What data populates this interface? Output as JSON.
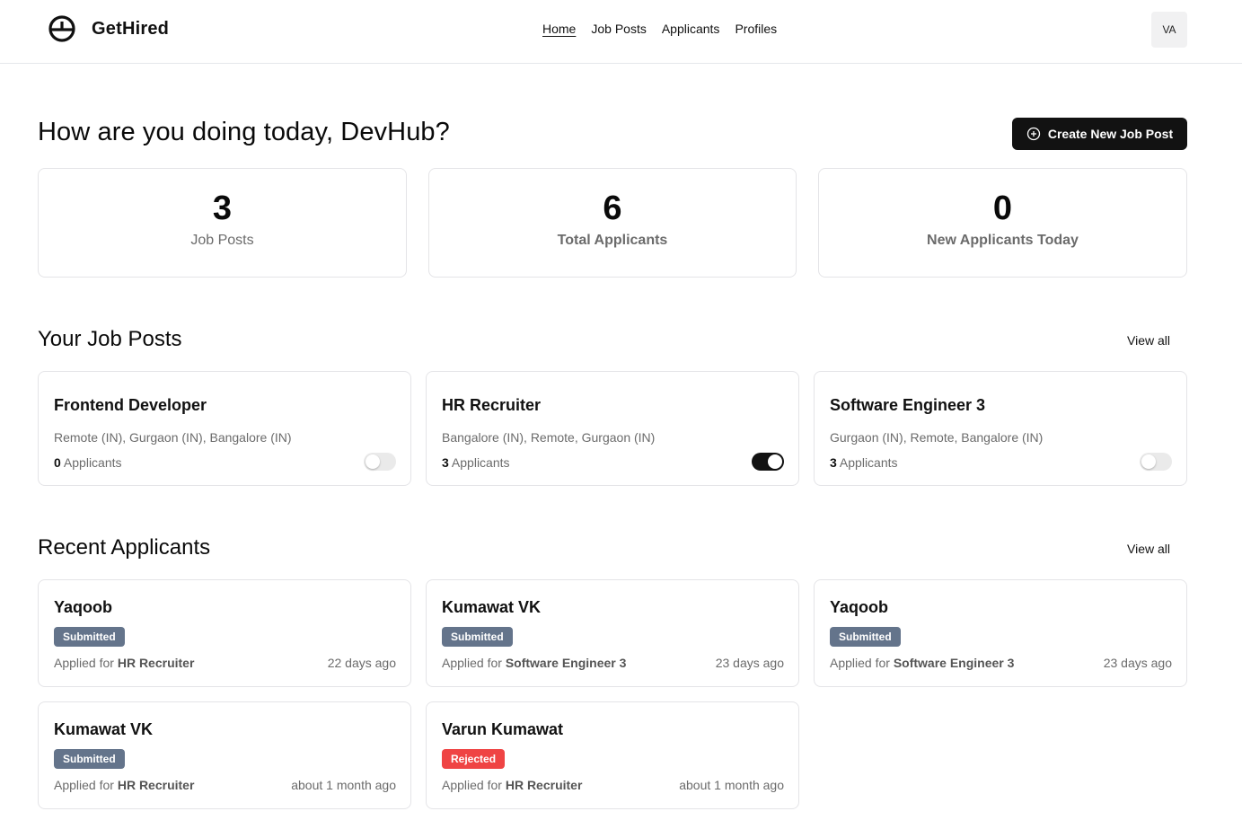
{
  "brand": {
    "name": "GetHired",
    "logo_icon": "brand-logo-icon"
  },
  "nav": [
    {
      "label": "Home",
      "active": true
    },
    {
      "label": "Job Posts",
      "active": false
    },
    {
      "label": "Applicants",
      "active": false
    },
    {
      "label": "Profiles",
      "active": false
    }
  ],
  "user": {
    "initials": "VA"
  },
  "greeting": "How are you doing today, DevHub?",
  "create_button": {
    "label": "Create New Job Post",
    "icon": "plus-circle-icon"
  },
  "stats": [
    {
      "value": "3",
      "label": "Job Posts"
    },
    {
      "value": "6",
      "label": "Total Applicants"
    },
    {
      "value": "0",
      "label": "New Applicants Today"
    }
  ],
  "job_posts_section": {
    "title": "Your Job Posts",
    "view_all": "View all",
    "items": [
      {
        "title": "Frontend Developer",
        "locations": "Remote (IN), Gurgaon (IN), Bangalore (IN)",
        "applicant_count": "0",
        "applicant_label": "Applicants",
        "active": false
      },
      {
        "title": "HR Recruiter",
        "locations": "Bangalore (IN), Remote, Gurgaon (IN)",
        "applicant_count": "3",
        "applicant_label": "Applicants",
        "active": true
      },
      {
        "title": "Software Engineer 3",
        "locations": "Gurgaon (IN), Remote, Bangalore (IN)",
        "applicant_count": "3",
        "applicant_label": "Applicants",
        "active": false
      }
    ]
  },
  "applicants_section": {
    "title": "Recent Applicants",
    "view_all": "View all",
    "applied_prefix": "Applied for",
    "items": [
      {
        "name": "Yaqoob",
        "status": "Submitted",
        "job": "HR Recruiter",
        "time": "22 days ago"
      },
      {
        "name": "Kumawat VK",
        "status": "Submitted",
        "job": "Software Engineer 3",
        "time": "23 days ago"
      },
      {
        "name": "Yaqoob",
        "status": "Submitted",
        "job": "Software Engineer 3",
        "time": "23 days ago"
      },
      {
        "name": "Kumawat VK",
        "status": "Submitted",
        "job": "HR Recruiter",
        "time": "about 1 month ago"
      },
      {
        "name": "Varun Kumawat",
        "status": "Rejected",
        "job": "HR Recruiter",
        "time": "about 1 month ago"
      }
    ]
  },
  "colors": {
    "primary": "#121212",
    "submitted": "#64748b",
    "rejected": "#ef4444",
    "border": "#e4e4e7",
    "muted": "#6b6b6b"
  }
}
